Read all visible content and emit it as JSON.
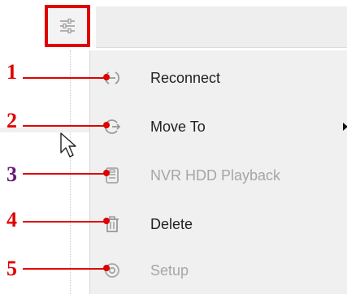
{
  "toolbar": {
    "settings_icon": "sliders-icon"
  },
  "menu": {
    "items": [
      {
        "label": "Reconnect",
        "icon": "reconnect-icon",
        "enabled": true
      },
      {
        "label": "Move To",
        "icon": "move-to-icon",
        "enabled": true,
        "has_submenu": true
      },
      {
        "label": "NVR HDD Playback",
        "icon": "hdd-playback-icon",
        "enabled": false
      },
      {
        "label": "Delete",
        "icon": "trash-icon",
        "enabled": true
      },
      {
        "label": "Setup",
        "icon": "setup-icon",
        "enabled": false
      }
    ]
  },
  "callouts": [
    {
      "number": "1",
      "color": "#e00000"
    },
    {
      "number": "2",
      "color": "#e00000"
    },
    {
      "number": "3",
      "color": "#6a1b7a"
    },
    {
      "number": "4",
      "color": "#e00000"
    },
    {
      "number": "5",
      "color": "#e00000"
    }
  ],
  "colors": {
    "highlight": "#e00000",
    "menu_bg": "#f0f0f0",
    "disabled_text": "#a6a6a6"
  }
}
